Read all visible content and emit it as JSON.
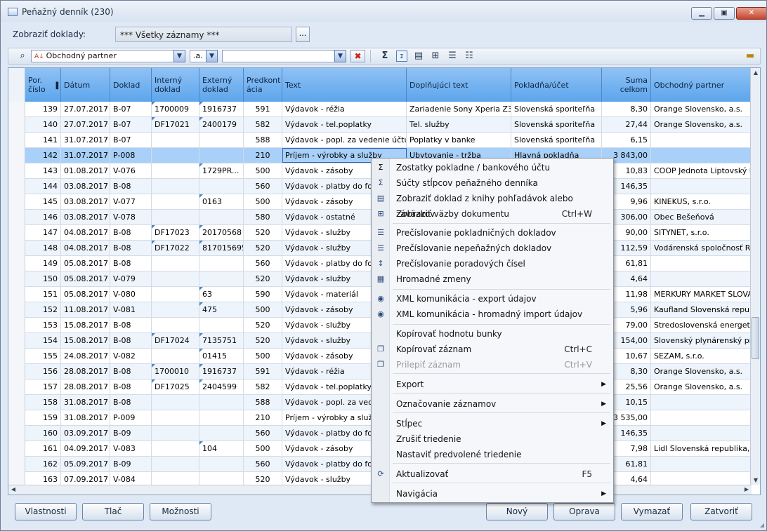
{
  "window": {
    "title": "Peňažný denník (230)",
    "min": "▁",
    "max": "▣",
    "close": "✕"
  },
  "filter": {
    "label": "Zobraziť doklady:",
    "value": "*** Všetky záznamy ***",
    "button": "..."
  },
  "toolbar": {
    "find_icon": "binoculars-icon",
    "field_combo": "Obchodný partner",
    "op_combo": ".a.",
    "value_combo": "",
    "clear": "✖",
    "icons": [
      "sum-icon",
      "sum-column-icon",
      "preview-icon",
      "links-icon",
      "renumber-icon",
      "renumber-alt-icon"
    ]
  },
  "columns": [
    "Por. číslo",
    "Dátum",
    "Doklad",
    "Interný doklad",
    "Externý doklad",
    "Predkont ácia",
    "Text",
    "Doplňujúci text",
    "Pokladňa/účet",
    "Suma celkom",
    "Obchodný partner"
  ],
  "rows": [
    [
      "139",
      "27.07.2017",
      "B-07",
      "1700009",
      "1916737",
      "591",
      "Výdavok - réžia",
      "Zariadenie Sony Xperia Z3",
      "Slovenská sporiteľňa",
      "8,30",
      "Orange Slovensko, a.s."
    ],
    [
      "140",
      "27.07.2017",
      "B-07",
      "DF17021",
      "2400179",
      "582",
      "Výdavok - tel.poplatky",
      "Tel. služby",
      "Slovenská sporiteľňa",
      "27,44",
      "Orange Slovensko, a.s."
    ],
    [
      "141",
      "31.07.2017",
      "B-07",
      "",
      "",
      "588",
      "Výdavok - popl. za vedenie účtu",
      "Poplatky v banke",
      "Slovenská sporiteľňa",
      "6,15",
      ""
    ],
    [
      "142",
      "31.07.2017",
      "P-008",
      "",
      "",
      "210",
      "Príjem - výrobky a služby",
      "Ubytovanie - tržba",
      "Hlavná pokladňa",
      "3 843,00",
      ""
    ],
    [
      "143",
      "01.08.2017",
      "V-076",
      "",
      "1729PR...",
      "500",
      "Výdavok - zásoby",
      "",
      "",
      "10,83",
      "COOP Jednota Liptovský M"
    ],
    [
      "144",
      "03.08.2017",
      "B-08",
      "",
      "",
      "560",
      "Výdavok - platby do fon",
      "",
      "",
      "146,35",
      ""
    ],
    [
      "145",
      "03.08.2017",
      "V-077",
      "",
      "0163",
      "500",
      "Výdavok - zásoby",
      "",
      "",
      "9,96",
      "KINEKUS, s.r.o."
    ],
    [
      "146",
      "03.08.2017",
      "V-078",
      "",
      "",
      "580",
      "Výdavok - ostatné",
      "",
      "",
      "306,00",
      "Obec Bešeňová"
    ],
    [
      "147",
      "04.08.2017",
      "B-08",
      "DF17023",
      "20170568",
      "520",
      "Výdavok - služby",
      "",
      "",
      "90,00",
      "SITYNET, s.r.o."
    ],
    [
      "148",
      "04.08.2017",
      "B-08",
      "DF17022",
      "817015695",
      "520",
      "Výdavok - služby",
      "",
      "",
      "112,59",
      "Vodárenská spoločnosť Ru"
    ],
    [
      "149",
      "05.08.2017",
      "B-08",
      "",
      "",
      "560",
      "Výdavok - platby do fon",
      "",
      "",
      "61,81",
      ""
    ],
    [
      "150",
      "05.08.2017",
      "V-079",
      "",
      "",
      "520",
      "Výdavok - služby",
      "",
      "",
      "4,64",
      ""
    ],
    [
      "151",
      "05.08.2017",
      "V-080",
      "",
      "63",
      "590",
      "Výdavok - materiál",
      "",
      "",
      "11,98",
      "MERKURY MARKET SLOVAKI"
    ],
    [
      "152",
      "11.08.2017",
      "V-081",
      "",
      "475",
      "500",
      "Výdavok - zásoby",
      "",
      "",
      "5,96",
      "Kaufland Slovenská republi"
    ],
    [
      "153",
      "15.08.2017",
      "B-08",
      "",
      "",
      "520",
      "Výdavok - služby",
      "",
      "",
      "79,00",
      "Stredoslovenská energetik"
    ],
    [
      "154",
      "15.08.2017",
      "B-08",
      "DF17024",
      "7135751",
      "520",
      "Výdavok - služby",
      "",
      "",
      "154,00",
      "Slovenský plynárenský prier"
    ],
    [
      "155",
      "24.08.2017",
      "V-082",
      "",
      "01415",
      "500",
      "Výdavok - zásoby",
      "",
      "",
      "10,67",
      "SEZAM, s.r.o."
    ],
    [
      "156",
      "28.08.2017",
      "B-08",
      "1700010",
      "1916737",
      "591",
      "Výdavok - réžia",
      "",
      "",
      "8,30",
      "Orange Slovensko, a.s."
    ],
    [
      "157",
      "28.08.2017",
      "B-08",
      "DF17025",
      "2404599",
      "582",
      "Výdavok - tel.poplatky",
      "",
      "",
      "25,56",
      "Orange Slovensko, a.s."
    ],
    [
      "158",
      "31.08.2017",
      "B-08",
      "",
      "",
      "588",
      "Výdavok - popl. za vede",
      "",
      "",
      "10,15",
      ""
    ],
    [
      "159",
      "31.08.2017",
      "P-009",
      "",
      "",
      "210",
      "Príjem - výrobky a služby",
      "",
      "",
      "3 535,00",
      ""
    ],
    [
      "160",
      "03.09.2017",
      "B-09",
      "",
      "",
      "560",
      "Výdavok - platby do fon",
      "",
      "",
      "146,35",
      ""
    ],
    [
      "161",
      "04.09.2017",
      "V-083",
      "",
      "104",
      "500",
      "Výdavok - zásoby",
      "",
      "",
      "7,98",
      "Lidl Slovenská republika, v."
    ],
    [
      "162",
      "05.09.2017",
      "B-09",
      "",
      "",
      "560",
      "Výdavok - platby do fon",
      "",
      "",
      "61,81",
      ""
    ],
    [
      "163",
      "07.09.2017",
      "V-084",
      "",
      "",
      "520",
      "Výdavok - služby",
      "",
      "",
      "4,64",
      ""
    ]
  ],
  "context_menu": [
    {
      "label": "Zostatky pokladne / bankového účtu",
      "icon": "sigma-icon",
      "shortcut": ""
    },
    {
      "label": "Súčty stĺpcov peňažného denníka",
      "icon": "sum-columns-icon",
      "shortcut": ""
    },
    {
      "label": "Zobraziť doklad z knihy pohľadávok alebo záväzkov",
      "icon": "document-preview-icon",
      "shortcut": ""
    },
    {
      "label": "Zobraziť väzby dokumentu",
      "icon": "document-links-icon",
      "shortcut": "Ctrl+W"
    },
    {
      "label": "Prečíslovanie pokladničných dokladov",
      "icon": "renumber-cash-icon",
      "shortcut": ""
    },
    {
      "label": "Prečíslovanie nepeňažných dokladov",
      "icon": "renumber-noncash-icon",
      "shortcut": ""
    },
    {
      "label": "Prečíslovanie poradových čísel",
      "icon": "renumber-order-icon",
      "shortcut": ""
    },
    {
      "label": "Hromadné zmeny",
      "icon": "bulk-change-icon",
      "shortcut": ""
    },
    {
      "label": "XML komunikácia - export údajov",
      "icon": "xml-export-icon",
      "shortcut": ""
    },
    {
      "label": "XML komunikácia - hromadný import údajov",
      "icon": "xml-import-icon",
      "shortcut": ""
    },
    {
      "label": "Kopírovať hodnotu bunky",
      "icon": "",
      "shortcut": ""
    },
    {
      "label": "Kopírovať záznam",
      "icon": "copy-icon",
      "shortcut": "Ctrl+C"
    },
    {
      "label": "Prilepiť záznam",
      "icon": "paste-icon",
      "shortcut": "Ctrl+V"
    },
    {
      "label": "Export",
      "icon": "",
      "shortcut": ""
    },
    {
      "label": "Označovanie záznamov",
      "icon": "",
      "shortcut": ""
    },
    {
      "label": "Stĺpec",
      "icon": "",
      "shortcut": ""
    },
    {
      "label": "Zrušiť triedenie",
      "icon": "",
      "shortcut": ""
    },
    {
      "label": "Nastaviť predvolené triedenie",
      "icon": "",
      "shortcut": ""
    },
    {
      "label": "Aktualizovať",
      "icon": "refresh-icon",
      "shortcut": "F5"
    },
    {
      "label": "Navigácia",
      "icon": "",
      "shortcut": ""
    }
  ],
  "buttons": {
    "vlastnosti": "Vlastnosti",
    "tlac": "Tlač",
    "moznosti": "Možnosti",
    "novy": "Nový",
    "oprava": "Oprava",
    "vymazat": "Vymazať",
    "zatvorit": "Zatvoriť"
  }
}
